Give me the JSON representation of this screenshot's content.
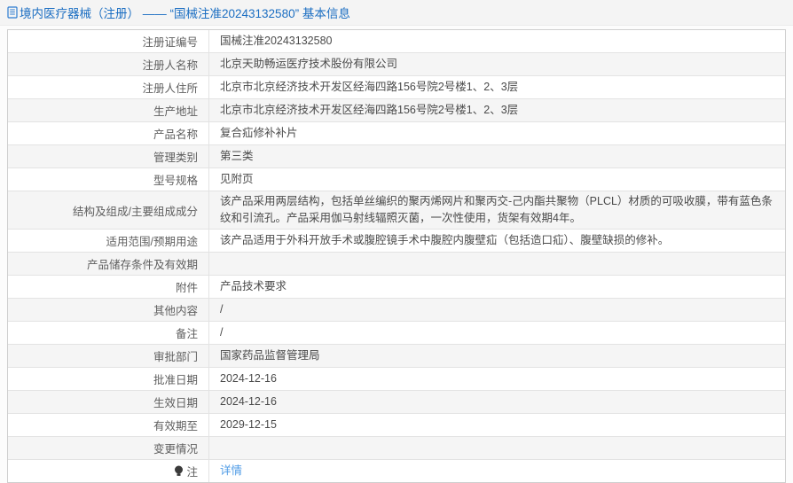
{
  "header": {
    "title": "境内医疗器械（注册） —— “国械注准20243132580” 基本信息"
  },
  "colors": {
    "header_blue": "#1b6ec2",
    "link_blue": "#4e9be6",
    "row_alt_gray": "#f5f5f5",
    "border_gray": "#cfcfcf"
  },
  "table": {
    "rows": [
      {
        "label": "注册证编号",
        "value": "国械注准20243132580"
      },
      {
        "label": "注册人名称",
        "value": "北京天助畅运医疗技术股份有限公司"
      },
      {
        "label": "注册人住所",
        "value": "北京市北京经济技术开发区经海四路156号院2号楼1、2、3层"
      },
      {
        "label": "生产地址",
        "value": "北京市北京经济技术开发区经海四路156号院2号楼1、2、3层"
      },
      {
        "label": "产品名称",
        "value": "复合疝修补补片"
      },
      {
        "label": "管理类别",
        "value": "第三类"
      },
      {
        "label": "型号规格",
        "value": "见附页"
      },
      {
        "label": "结构及组成/主要组成成分",
        "value": "该产品采用两层结构，包括单丝编织的聚丙烯网片和聚丙交-己内酯共聚物（PLCL）材质的可吸收膜，带有蓝色条纹和引流孔。产品采用伽马射线辐照灭菌，一次性使用，货架有效期4年。"
      },
      {
        "label": "适用范围/预期用途",
        "value": "该产品适用于外科开放手术或腹腔镜手术中腹腔内腹壁疝（包括造口疝）、腹壁缺损的修补。"
      },
      {
        "label": "产品储存条件及有效期",
        "value": ""
      },
      {
        "label": "附件",
        "value": "产品技术要求"
      },
      {
        "label": "其他内容",
        "value": "/"
      },
      {
        "label": "备注",
        "value": "/"
      },
      {
        "label": "审批部门",
        "value": "国家药品监督管理局"
      },
      {
        "label": "批准日期",
        "value": "2024-12-16"
      },
      {
        "label": "生效日期",
        "value": "2024-12-16"
      },
      {
        "label": "有效期至",
        "value": "2029-12-15"
      },
      {
        "label": "变更情况",
        "value": ""
      },
      {
        "label": "注",
        "value": "详情"
      }
    ]
  }
}
